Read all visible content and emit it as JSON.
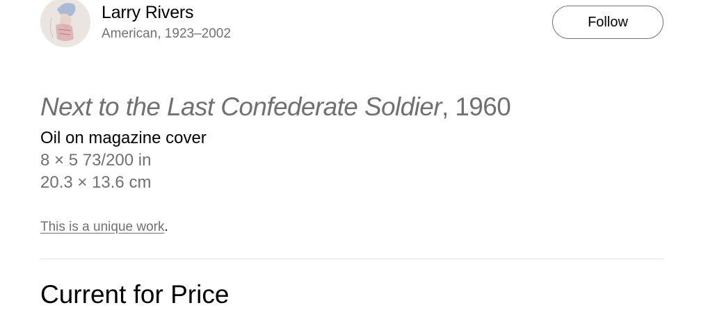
{
  "artist": {
    "name": "Larry Rivers",
    "meta": "American, 1923–2002",
    "follow_label": "Follow"
  },
  "artwork": {
    "title": "Next to the Last Confederate Soldier",
    "title_separator": ", ",
    "year": "1960",
    "medium": "Oil on magazine cover",
    "dimensions_in": "8 × 5 73/200 in",
    "dimensions_cm": "20.3 × 13.6 cm",
    "unique_link": "This is a unique work",
    "unique_suffix": "."
  },
  "next_section": {
    "heading": "Current for Price"
  },
  "colors": {
    "text": "#000000",
    "secondary": "#707070",
    "divider": "#e5e5e5",
    "button_border": "#707070"
  },
  "icons": {
    "avatar": "artist-portrait-image"
  }
}
